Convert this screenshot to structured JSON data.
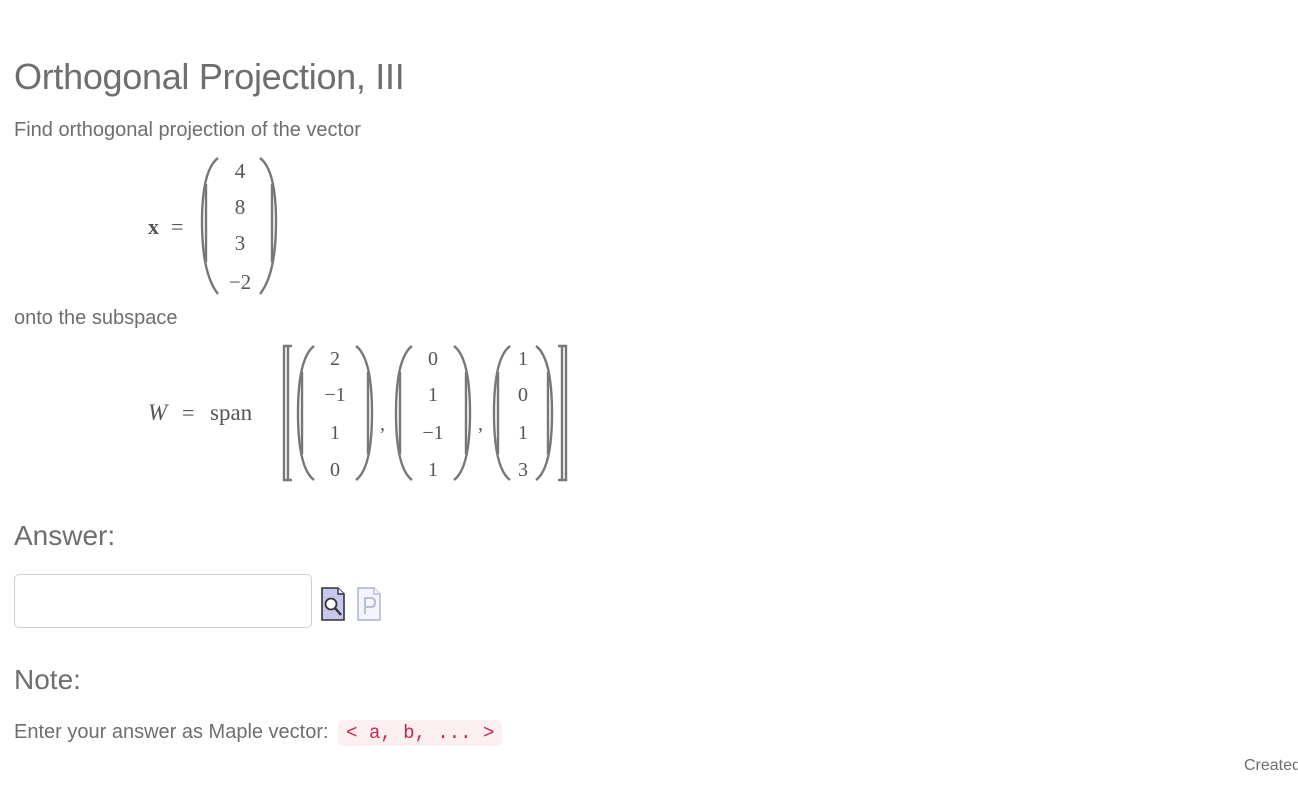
{
  "title": "Orthogonal Projection, III",
  "prompt": {
    "intro": "Find orthogonal projection of the vector",
    "onto": "onto the subspace"
  },
  "vector_x": {
    "symbol": "x",
    "equals": "=",
    "entries": [
      "4",
      "8",
      "3",
      "−2"
    ]
  },
  "subspace_W": {
    "symbol": "W",
    "equals": "=",
    "operator": "span",
    "separator": ",",
    "vectors": [
      [
        "2",
        "−1",
        "1",
        "0"
      ],
      [
        "0",
        "1",
        "−1",
        "1"
      ],
      [
        "1",
        "0",
        "1",
        "3"
      ]
    ]
  },
  "answer": {
    "heading": "Answer:",
    "value": "",
    "placeholder": ""
  },
  "icons": {
    "preview": "preview-icon",
    "maple_syntax": "maple-syntax-icon"
  },
  "note": {
    "heading": "Note:",
    "text": "Enter your answer as Maple vector:",
    "code": "< a, b, ... >"
  },
  "footer": {
    "text": "Created"
  }
}
